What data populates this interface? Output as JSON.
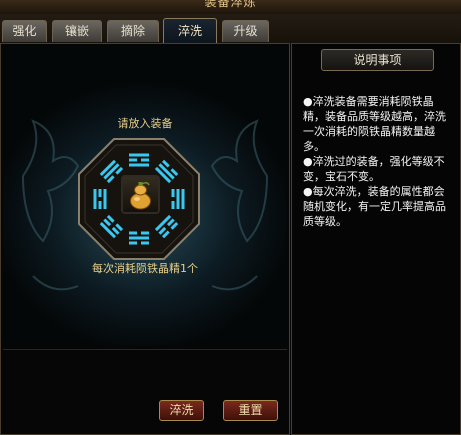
{
  "window": {
    "title": "装备淬炼"
  },
  "tabs": [
    {
      "label": "强化",
      "active": false
    },
    {
      "label": "镶嵌",
      "active": false
    },
    {
      "label": "摘除",
      "active": false
    },
    {
      "label": "淬洗",
      "active": true
    },
    {
      "label": "升级",
      "active": false
    }
  ],
  "main": {
    "prompt": "请放入装备",
    "cost_text": "每次消耗陨铁晶精1个"
  },
  "buttons": {
    "wash_label": "淬洗",
    "reset_label": "重置"
  },
  "info": {
    "title": "说明事项",
    "paragraphs": [
      "●淬洗装备需要消耗陨铁晶精，装备品质等级越高，淬洗一次消耗的陨铁晶精数量越多。",
      "●淬洗过的装备，强化等级不变，宝石不变。",
      "●每次淬洗，装备的属性都会随机变化，有一定几率提高品质等级。"
    ]
  },
  "colors": {
    "accent_gold": "#e8cf8a",
    "rune_blue": "#39c8f0",
    "button_red": "#7a2a1e"
  },
  "slot_item_icon": "gourd-icon"
}
